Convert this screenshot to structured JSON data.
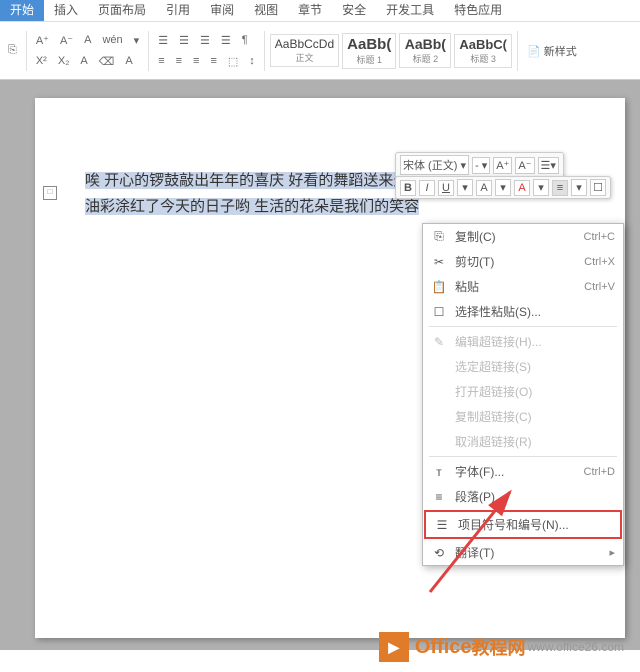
{
  "tabs": [
    "开始",
    "插入",
    "页面布局",
    "引用",
    "审阅",
    "视图",
    "章节",
    "安全",
    "开发工具",
    "特色应用"
  ],
  "activeTab": 0,
  "ribbon": {
    "r1": [
      "A⁺",
      "A⁻",
      "A",
      "wén",
      "▾"
    ],
    "r2": [
      "X²",
      "X₂",
      "A",
      "⌫",
      "A"
    ],
    "para1": [
      "☰",
      "☰",
      "☰",
      "☰",
      "¶"
    ],
    "para2": [
      "≡",
      "≡",
      "≡",
      "≡",
      "⬚",
      "↕"
    ],
    "styles": [
      {
        "sample": "AaBbCcDd",
        "name": "正文"
      },
      {
        "sample": "AaBb(",
        "name": "标题 1"
      },
      {
        "sample": "AaBb(",
        "name": "标题 2"
      },
      {
        "sample": "AaBbC(",
        "name": "标题 3"
      }
    ],
    "newStyle": "新样式"
  },
  "miniToolbar": {
    "font": "宋体 (正文) ▾",
    "size": "- ▾",
    "btns": [
      "A⁺",
      "A⁻",
      "☰▾"
    ],
    "row2": [
      "B",
      "I",
      "U",
      "▾",
      "A",
      "▾",
      "A",
      "▾",
      "≡",
      "▾",
      "☐"
    ]
  },
  "doc": {
    "line1": "唉 开心的锣鼓敲出年年的喜庆 好看的舞蹈送来天一",
    "line2": "油彩涂红了今天的日子哟 生活的花朵是我们的笑容"
  },
  "ctx": [
    {
      "ico": "⎘",
      "lbl": "复制(C)",
      "sc": "Ctrl+C",
      "en": true
    },
    {
      "ico": "✂",
      "lbl": "剪切(T)",
      "sc": "Ctrl+X",
      "en": true
    },
    {
      "ico": "📋",
      "lbl": "粘贴",
      "sc": "Ctrl+V",
      "en": true
    },
    {
      "ico": "☐",
      "lbl": "选择性粘贴(S)...",
      "sc": "",
      "en": true
    },
    {
      "sep": true
    },
    {
      "ico": "✎",
      "lbl": "编辑超链接(H)...",
      "sc": "",
      "en": false
    },
    {
      "ico": "",
      "lbl": "选定超链接(S)",
      "sc": "",
      "en": false
    },
    {
      "ico": "",
      "lbl": "打开超链接(O)",
      "sc": "",
      "en": false
    },
    {
      "ico": "",
      "lbl": "复制超链接(C)",
      "sc": "",
      "en": false
    },
    {
      "ico": "",
      "lbl": "取消超链接(R)",
      "sc": "",
      "en": false
    },
    {
      "sep": true
    },
    {
      "ico": "ᴛ",
      "lbl": "字体(F)...",
      "sc": "Ctrl+D",
      "en": true
    },
    {
      "ico": "≡",
      "lbl": "段落(P)...",
      "sc": "",
      "en": true
    },
    {
      "ico": "☰",
      "lbl": "项目符号和编号(N)...",
      "sc": "",
      "en": true,
      "hl": true
    },
    {
      "ico": "⟲",
      "lbl": "翻译(T)",
      "sc": "",
      "en": true,
      "arrow": true
    }
  ],
  "watermark": {
    "brand": "Office",
    "cn": "教程网",
    "url": "www.office26.com"
  }
}
